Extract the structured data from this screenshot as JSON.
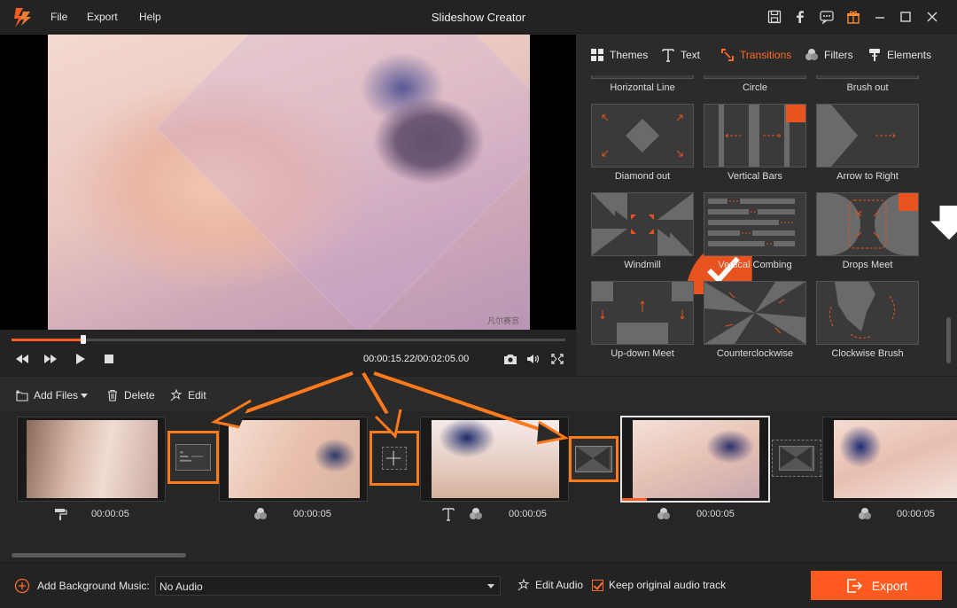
{
  "app": {
    "title": "Slideshow Creator",
    "menu": [
      "File",
      "Export",
      "Help"
    ],
    "accent": "#ff5a1f"
  },
  "preview": {
    "watermark": "凡尔赛宫",
    "timecode": "00:00:15.22/00:02:05.00",
    "progress": 0.13
  },
  "panel_tabs": [
    {
      "label": "Themes",
      "icon": "grid-icon",
      "active": false
    },
    {
      "label": "Text",
      "icon": "text-icon",
      "active": false
    },
    {
      "label": "Transitions",
      "icon": "transitions-icon",
      "active": true
    },
    {
      "label": "Filters",
      "icon": "filters-icon",
      "active": false
    },
    {
      "label": "Elements",
      "icon": "elements-icon",
      "active": false
    }
  ],
  "transitions": {
    "top_row": [
      "Horizontal Line",
      "Circle",
      "Brush out"
    ],
    "grid": [
      {
        "label": "Diamond out",
        "download": false,
        "selected": false
      },
      {
        "label": "Vertical Bars",
        "download": true,
        "selected": false
      },
      {
        "label": "Arrow to Right",
        "download": false,
        "selected": false
      },
      {
        "label": "Windmill",
        "download": false,
        "selected": true
      },
      {
        "label": "Vertical Combing",
        "download": false,
        "selected": false
      },
      {
        "label": "Drops Meet",
        "download": true,
        "selected": false
      },
      {
        "label": "Up-down Meet",
        "download": false,
        "selected": false
      },
      {
        "label": "Counterclockwise",
        "download": false,
        "selected": false
      },
      {
        "label": "Clockwise Brush",
        "download": false,
        "selected": false
      }
    ]
  },
  "toolbar": {
    "add_files": "Add Files",
    "delete": "Delete",
    "edit": "Edit"
  },
  "timeline": {
    "clips": [
      {
        "duration": "00:00:05",
        "icons": [
          "paint-roller-icon"
        ],
        "selected": false
      },
      {
        "duration": "00:00:05",
        "icons": [
          "filters-icon"
        ],
        "selected": false
      },
      {
        "duration": "00:00:05",
        "icons": [
          "text-icon",
          "filters-icon"
        ],
        "selected": false
      },
      {
        "duration": "00:00:05",
        "icons": [
          "filters-icon"
        ],
        "selected": true
      },
      {
        "duration": "00:00:05",
        "icons": [
          "filters-icon"
        ],
        "selected": false
      }
    ]
  },
  "bottom": {
    "add_music": "Add Background Music:",
    "audio_value": "No Audio",
    "edit_audio": "Edit Audio",
    "keep_audio": "Keep original audio track",
    "export": "Export"
  }
}
